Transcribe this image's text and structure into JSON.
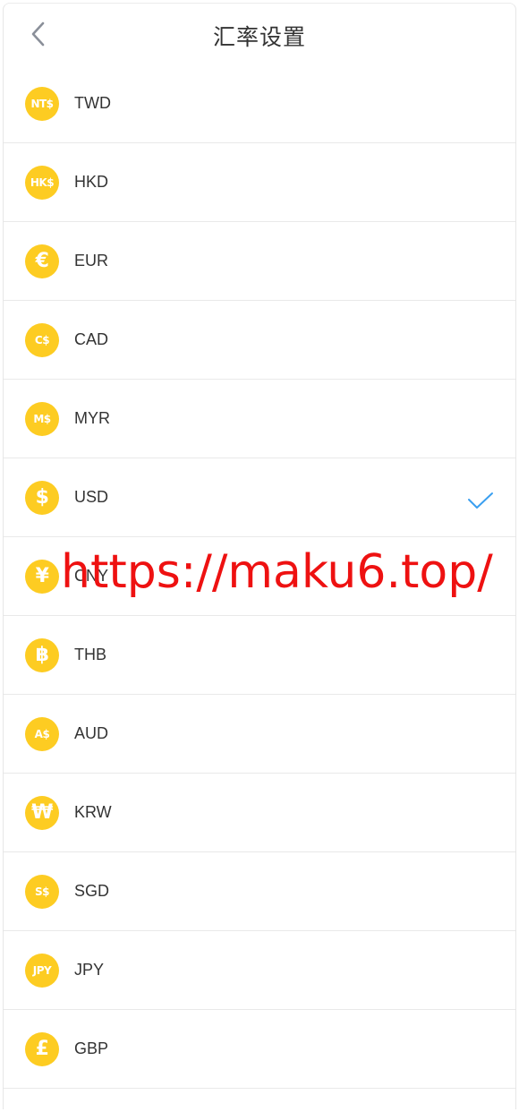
{
  "header": {
    "title": "汇率设置",
    "back_icon": "chevron-left-icon"
  },
  "currencies": [
    {
      "code": "TWD",
      "symbol": "NT$",
      "selected": false
    },
    {
      "code": "HKD",
      "symbol": "HK$",
      "selected": false
    },
    {
      "code": "EUR",
      "symbol": "€",
      "selected": false
    },
    {
      "code": "CAD",
      "symbol": "C$",
      "selected": false
    },
    {
      "code": "MYR",
      "symbol": "M$",
      "selected": false
    },
    {
      "code": "USD",
      "symbol": "$",
      "selected": true
    },
    {
      "code": "CNY",
      "symbol": "¥",
      "selected": false
    },
    {
      "code": "THB",
      "symbol": "฿",
      "selected": false
    },
    {
      "code": "AUD",
      "symbol": "A$",
      "selected": false
    },
    {
      "code": "KRW",
      "symbol": "₩",
      "selected": false
    },
    {
      "code": "SGD",
      "symbol": "S$",
      "selected": false
    },
    {
      "code": "JPY",
      "symbol": "JPY",
      "selected": false
    },
    {
      "code": "GBP",
      "symbol": "£",
      "selected": false
    }
  ],
  "watermark": "https://maku6.top/",
  "colors": {
    "coin": "#fdcc22",
    "check": "#3a9ff0",
    "back_arrow": "#8a8f99",
    "watermark": "#ee1111"
  }
}
